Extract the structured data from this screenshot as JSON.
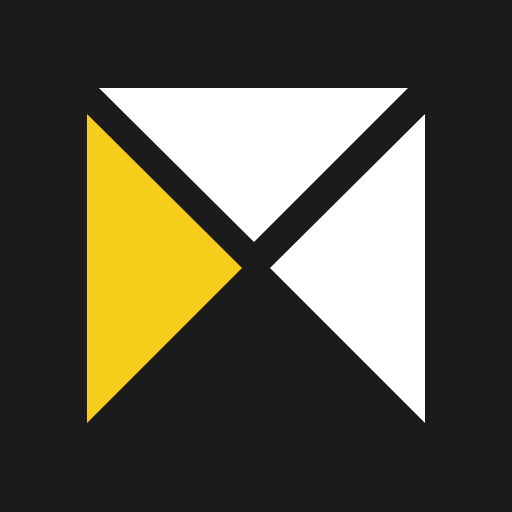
{
  "icon": {
    "name": "mail-envelope-logo-icon",
    "background_color": "#1b1b1b",
    "colors": {
      "flap": "#ffffff",
      "left_panel": "#f6cd1b",
      "right_panel": "#ffffff"
    }
  }
}
